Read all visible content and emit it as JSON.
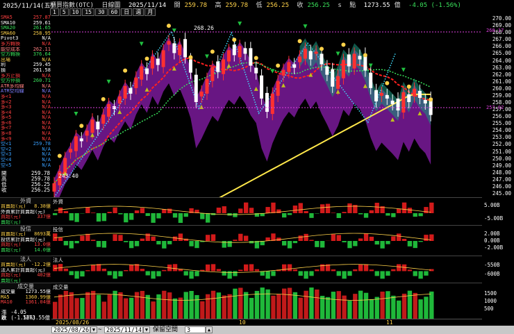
{
  "header": {
    "date": "2025/11/14(五)",
    "instrument": "櫃買指數(OTC)",
    "period": "日線圖",
    "bar_date": "2025/11/14",
    "open_label": "開",
    "open": "259.78",
    "high_label": "高",
    "high": "259.78",
    "low_label": "低",
    "low": "256.25",
    "close_label": "收",
    "close": "256.25",
    "s_label": "s",
    "points_label": "點",
    "value": "1273.55",
    "value_label": "億",
    "change": "-4.05 (-1.56%)"
  },
  "period_buttons": [
    "1",
    "5",
    "10",
    "15",
    "30",
    "60",
    "日",
    "週",
    "月"
  ],
  "indicators": [
    {
      "label": "SMA5",
      "value": "257.87",
      "color": "#ff4040"
    },
    {
      "label": "SMA10",
      "value": "259.61",
      "color": "#ffffff"
    },
    {
      "label": "SMA20",
      "value": "261.65",
      "color": "#39e05a"
    },
    {
      "label": "SMA60",
      "value": "258.95",
      "color": "#ffd24a"
    },
    {
      "label": "Pivot3",
      "value": "N/A",
      "color": "#ffffff"
    },
    {
      "label": "多方轉換",
      "value": "N/A",
      "color": "#ff4040"
    },
    {
      "label": "能空成本",
      "value": "262.11",
      "color": "#ff8080"
    },
    {
      "label": "空方轉換",
      "value": "376.64",
      "color": "#39e05a"
    },
    {
      "label": "出場",
      "value": "N/A",
      "color": "#ffd24a"
    },
    {
      "label": "利",
      "value": "259.45",
      "color": "#ffffff"
    },
    {
      "label": "損",
      "value": "261.58",
      "color": "#ffffff"
    },
    {
      "label": "多方止損",
      "value": "N/A",
      "color": "#ff4040"
    },
    {
      "label": "空方停損",
      "value": "260.71",
      "color": "#39e05a"
    },
    {
      "label": "ATR多均線",
      "value": "N/A",
      "color": "#ff8080"
    },
    {
      "label": "ATR空均線",
      "value": "N/A",
      "color": "#8080ff"
    },
    {
      "label": "多<1",
      "value": "N/A",
      "color": "#ff4040"
    },
    {
      "label": "多<2",
      "value": "N/A",
      "color": "#ff4040"
    },
    {
      "label": "多<3",
      "value": "N/A",
      "color": "#ff4040"
    },
    {
      "label": "多<4",
      "value": "N/A",
      "color": "#ff4040"
    },
    {
      "label": "多<5",
      "value": "N/A",
      "color": "#ff4040"
    },
    {
      "label": "多<6",
      "value": "N/A",
      "color": "#ff4040"
    },
    {
      "label": "多<7",
      "value": "N/A",
      "color": "#ff4040"
    },
    {
      "label": "多<8",
      "value": "N/A",
      "color": "#ff4040"
    },
    {
      "label": "多<9",
      "value": "N/A",
      "color": "#ff4040"
    },
    {
      "label": "空<1",
      "value": "259.78",
      "color": "#39a0ff"
    },
    {
      "label": "空<2",
      "value": "N/A",
      "color": "#39a0ff"
    },
    {
      "label": "空<3",
      "value": "N/A",
      "color": "#39a0ff"
    },
    {
      "label": "空<4",
      "value": "N/A",
      "color": "#39a0ff"
    },
    {
      "label": "空<5",
      "value": "N/A",
      "color": "#39a0ff"
    }
  ],
  "ohlc_summary": [
    {
      "label": "開",
      "value": "259.78"
    },
    {
      "label": "高",
      "value": "259.78"
    },
    {
      "label": "低",
      "value": "256.25"
    },
    {
      "label": "收",
      "value": "256.25"
    }
  ],
  "pane_foreign": {
    "title": "外資",
    "legend_title": "外資",
    "rows": [
      {
        "label": "買賣超(元)",
        "value": "8.38億",
        "color": "#ffd24a"
      },
      {
        "label": "外資累計買賣超(元)",
        "value": "",
        "color": "#ffffff"
      },
      {
        "label": "買超(元)",
        "value": "337億",
        "color": "#ff4040"
      },
      {
        "label": "賣超(元)",
        "value": "",
        "color": "#39e05a"
      }
    ],
    "axis": [
      "5.00B",
      "-5.00B"
    ]
  },
  "pane_dealer": {
    "title": "投信",
    "legend_title": "投信",
    "rows": [
      {
        "label": "買賣超(元)",
        "value": "8693萬",
        "color": "#ffd24a"
      },
      {
        "label": "投信累計買賣超(元)",
        "value": "",
        "color": "#ffffff"
      },
      {
        "label": "買超(元)",
        "value": "13.0億",
        "color": "#ff4040"
      },
      {
        "label": "賣超(元)",
        "value": "14.0億",
        "color": "#39e05a"
      }
    ],
    "axis": [
      "2.00B",
      "0.00B",
      "-2.00B"
    ]
  },
  "pane_corp": {
    "title": "法人",
    "legend_title": "法人",
    "rows": [
      {
        "label": "買賣超(元)",
        "value": "-12.2億",
        "color": "#ffd24a"
      },
      {
        "label": "法人累計買賣超(元)",
        "value": "",
        "color": "#ffffff"
      },
      {
        "label": "買超(元)",
        "value": "402億",
        "color": "#ff4040"
      },
      {
        "label": "賣超(元)",
        "value": "",
        "color": "#39e05a"
      }
    ],
    "axis": [
      "-550B",
      "-600B"
    ]
  },
  "pane_volume": {
    "title": "成交量",
    "legend_title": "成交量",
    "rows": [
      {
        "label": "成交量",
        "value": "1273.55億",
        "color": "#ffffff"
      },
      {
        "label": "MA5",
        "value": "1360.99億",
        "color": "#ffd24a"
      },
      {
        "label": "MA10",
        "value": "1361.04億",
        "color": "#ff4040"
      }
    ],
    "axis": [
      "1500",
      "1000",
      "500"
    ]
  },
  "footer_left": {
    "change_label": "漲跌",
    "change": "-4.05 (-1.56%)",
    "close_label": "收",
    "close": "1273.55億"
  },
  "price_axis": [
    "270.00",
    "269.00",
    "268.00",
    "267.00",
    "266.00",
    "265.00",
    "264.00",
    "263.00",
    "262.00",
    "261.00",
    "260.00",
    "259.00",
    "258.00",
    "257.00",
    "256.00",
    "255.00",
    "254.00",
    "253.00",
    "252.00",
    "251.00",
    "250.00",
    "249.00",
    "248.00",
    "247.00",
    "246.00",
    "245.00"
  ],
  "marks": {
    "resistance": "268.17",
    "support": "257.02",
    "peak": "268.26",
    "trough": "243.40"
  },
  "time_axis": {
    "start": "2025/08/26",
    "m10": "10",
    "m11": "11"
  },
  "controls": {
    "start_date": "2025/08/26",
    "end_date": "2025/11/14",
    "tilde": "~",
    "space_label": "保留空間",
    "space_value": "3"
  },
  "chart_data": {
    "type": "candlestick",
    "ylim": [
      244.5,
      270.5
    ],
    "closes": [
      246.5,
      248.2,
      250.1,
      251.4,
      253.2,
      252.5,
      254.0,
      255.6,
      254.2,
      256.3,
      257.8,
      257.1,
      258.9,
      260.4,
      259.3,
      261.6,
      263.2,
      262.1,
      264.6,
      263.4,
      265.5,
      266.8,
      265.1,
      266.3,
      264.5,
      262.3,
      258.1,
      259.6,
      261.4,
      263.1,
      262.4,
      264.2,
      265.5,
      264.8,
      266.1,
      265.0,
      263.3,
      262.2,
      258.6,
      256.7,
      259.3,
      261.1,
      262.7,
      263.8,
      263.0,
      264.6,
      265.7,
      264.2,
      265.3,
      263.5,
      262.0,
      260.3,
      261.8,
      264.1,
      263.2,
      265.0,
      264.2,
      262.6,
      260.1,
      258.2,
      259.4,
      258.6,
      257.8,
      256.9,
      259.5,
      258.1,
      260.0,
      258.7,
      257.9,
      256.25
    ]
  }
}
